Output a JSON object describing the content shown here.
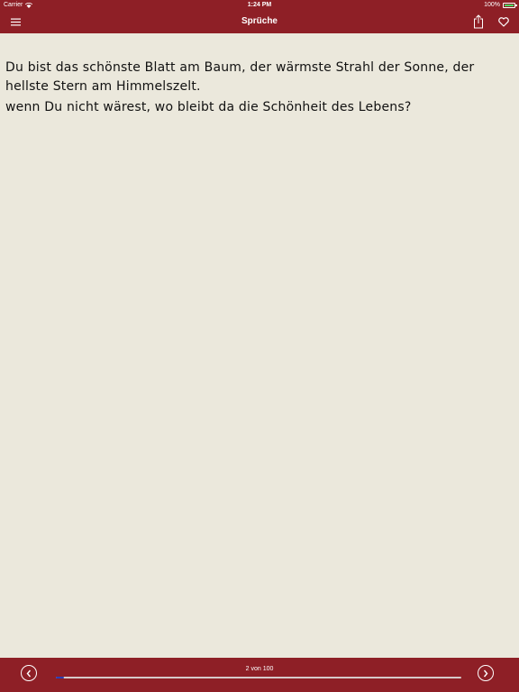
{
  "status_bar": {
    "carrier": "Carrier",
    "time": "1:24 PM",
    "battery": "100%",
    "battery_level": 1.0
  },
  "header": {
    "title": "Sprüche",
    "menu_icon": "hamburger-menu-icon",
    "share_icon": "share-icon",
    "favorite_icon": "heart-icon"
  },
  "quote": {
    "line1": "Du bist das schönste Blatt am Baum, der wärmste Strahl der Sonne, der hellste Stern am Himmelszelt.",
    "line2": "wenn Du nicht wärest, wo bleibt da die Schönheit des Lebens?"
  },
  "footer": {
    "page_indicator": "2 von 100",
    "current_page": 2,
    "total_pages": 100,
    "prev_icon": "chevron-left-circle-icon",
    "next_icon": "chevron-right-circle-icon"
  },
  "colors": {
    "brand": "#8e1f26",
    "background": "#ebe8dc",
    "slider_fill": "#2b3fb6",
    "battery": "#4cd964"
  }
}
